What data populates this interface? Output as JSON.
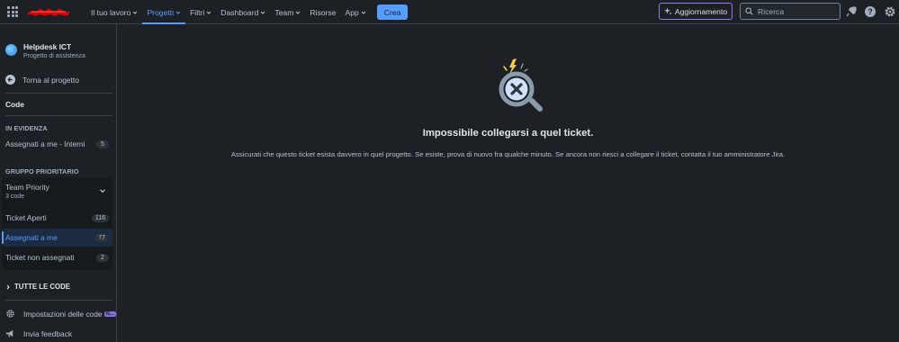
{
  "topbar": {
    "logo_text": "Vodafone",
    "nav": [
      {
        "label": "Il tuo lavoro",
        "dropdown": true,
        "active": false
      },
      {
        "label": "Progetti",
        "dropdown": true,
        "active": true
      },
      {
        "label": "Filtri",
        "dropdown": true,
        "active": false
      },
      {
        "label": "Dashboard",
        "dropdown": true,
        "active": false
      },
      {
        "label": "Team",
        "dropdown": true,
        "active": false
      },
      {
        "label": "Risorse",
        "dropdown": false,
        "active": false
      },
      {
        "label": "App",
        "dropdown": true,
        "active": false
      }
    ],
    "create_label": "Crea",
    "upgrade_label": "Aggiornamento",
    "search_placeholder": "Ricerca",
    "icons": [
      "notifications-icon",
      "help-icon",
      "settings-icon"
    ]
  },
  "sidebar": {
    "project_name": "Helpdesk ICT",
    "project_type": "Progetto di assistenza",
    "back_label": "Torna al progetto",
    "section_title": "Code",
    "featured_heading": "IN EVIDENZA",
    "featured": [
      {
        "label": "Assegnati a me - Interni",
        "count": "5"
      }
    ],
    "priority_heading": "GRUPPO PRIORITARIO",
    "team_priority": {
      "label": "Team Priority",
      "sub": "3 code"
    },
    "priority_queues": [
      {
        "label": "Ticket Aperti",
        "count": "116",
        "selected": false
      },
      {
        "label": "Assegnati a me",
        "count": "77",
        "selected": true
      },
      {
        "label": "Ticket non assegnati",
        "count": "2",
        "selected": false
      }
    ],
    "all_queues_label": "TUTTE LE CODE",
    "settings_label": "Impostazioni delle code",
    "settings_badge": "N...",
    "feedback_label": "Invia feedback"
  },
  "main": {
    "title": "Impossibile collegarsi a quel ticket.",
    "message": "Assicurati che questo ticket esista davvero in quel progetto. Se esiste, prova di nuovo fra qualche minuto. Se ancora non riesci a collegare il ticket, contatta il tuo amministratore Jira."
  },
  "colors": {
    "background": "#1d2125",
    "accent": "#579dff",
    "text": "#b6c2cf",
    "upgrade_border": "#8f7ee7"
  }
}
